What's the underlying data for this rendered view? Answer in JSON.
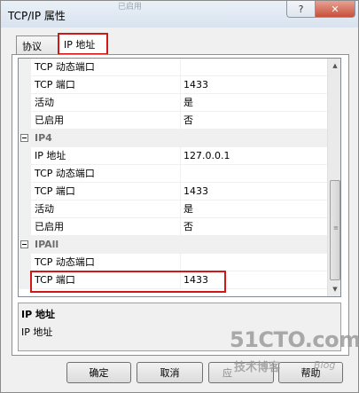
{
  "window": {
    "title": "TCP/IP 属性",
    "background_text": [
      "",
      "已启用"
    ],
    "help_button": "?",
    "close_button": "✕"
  },
  "tabs": [
    {
      "label": "协议"
    },
    {
      "label": "IP 地址"
    }
  ],
  "grid": {
    "rows": [
      {
        "kind": "prop",
        "name": "TCP 动态端口",
        "value": ""
      },
      {
        "kind": "prop",
        "name": "TCP 端口",
        "value": "1433"
      },
      {
        "kind": "prop",
        "name": "活动",
        "value": "是"
      },
      {
        "kind": "prop",
        "name": "已启用",
        "value": "否"
      },
      {
        "kind": "cat",
        "name": "IP4",
        "value": ""
      },
      {
        "kind": "prop",
        "name": "IP 地址",
        "value": "127.0.0.1"
      },
      {
        "kind": "prop",
        "name": "TCP 动态端口",
        "value": ""
      },
      {
        "kind": "prop",
        "name": "TCP 端口",
        "value": "1433"
      },
      {
        "kind": "prop",
        "name": "活动",
        "value": "是"
      },
      {
        "kind": "prop",
        "name": "已启用",
        "value": "否"
      },
      {
        "kind": "cat",
        "name": "IPAll",
        "value": ""
      },
      {
        "kind": "prop",
        "name": "TCP 动态端口",
        "value": ""
      },
      {
        "kind": "prop",
        "name": "TCP 端口",
        "value": "1433"
      }
    ],
    "scroll_up": "▲",
    "scroll_down": "▼"
  },
  "description": {
    "title": "IP 地址",
    "text": "IP 地址"
  },
  "buttons": {
    "ok": "确定",
    "cancel": "取消",
    "apply": "应",
    "help": "帮助"
  },
  "watermark": {
    "line1": "51CTO.com",
    "line2": "技术博客",
    "line3": "Blog"
  },
  "colors": {
    "highlight": "#d01818",
    "category_bg": "#f0f0f0"
  }
}
